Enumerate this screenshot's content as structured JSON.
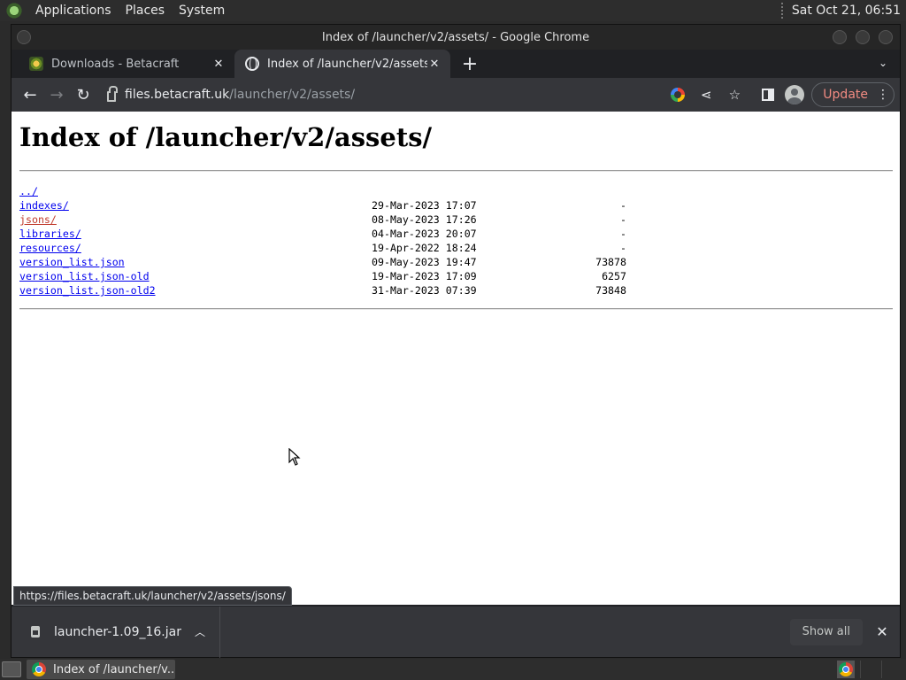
{
  "desktop": {
    "menus": [
      "Applications",
      "Places",
      "System"
    ],
    "clock": "Sat Oct 21, 06:51"
  },
  "window": {
    "title": "Index of /launcher/v2/assets/ - Google Chrome"
  },
  "tabs": [
    {
      "title": "Downloads - Betacraft",
      "favicon": "betacraft-icon",
      "active": false
    },
    {
      "title": "Index of /launcher/v2/assets/",
      "favicon": "globe-icon",
      "active": true
    }
  ],
  "toolbar": {
    "url_host": "files.betacraft.uk",
    "url_path": "/launcher/v2/assets/",
    "update_label": "Update"
  },
  "page": {
    "heading": "Index of /launcher/v2/assets/",
    "entries": [
      {
        "name": "../",
        "date": "",
        "size": "",
        "visited": false
      },
      {
        "name": "indexes/",
        "date": "29-Mar-2023 17:07",
        "size": "-",
        "visited": false
      },
      {
        "name": "jsons/",
        "date": "08-May-2023 17:26",
        "size": "-",
        "visited": true
      },
      {
        "name": "libraries/",
        "date": "04-Mar-2023 20:07",
        "size": "-",
        "visited": false
      },
      {
        "name": "resources/",
        "date": "19-Apr-2022 18:24",
        "size": "-",
        "visited": false
      },
      {
        "name": "version_list.json",
        "date": "09-May-2023 19:47",
        "size": "73878",
        "visited": false
      },
      {
        "name": "version_list.json-old",
        "date": "19-Mar-2023 17:09",
        "size": "6257",
        "visited": false
      },
      {
        "name": "version_list.json-old2",
        "date": "31-Mar-2023 07:39",
        "size": "73848",
        "visited": false
      }
    ]
  },
  "status_url": "https://files.betacraft.uk/launcher/v2/assets/jsons/",
  "downloads": {
    "file": "launcher-1.09_16.jar",
    "show_all_label": "Show all"
  },
  "taskbar": {
    "task_label": "Index of /launcher/v..."
  },
  "colors": {
    "link": "#0000ee",
    "visited_link": "#c0392b",
    "update_accent": "#f28b82"
  }
}
